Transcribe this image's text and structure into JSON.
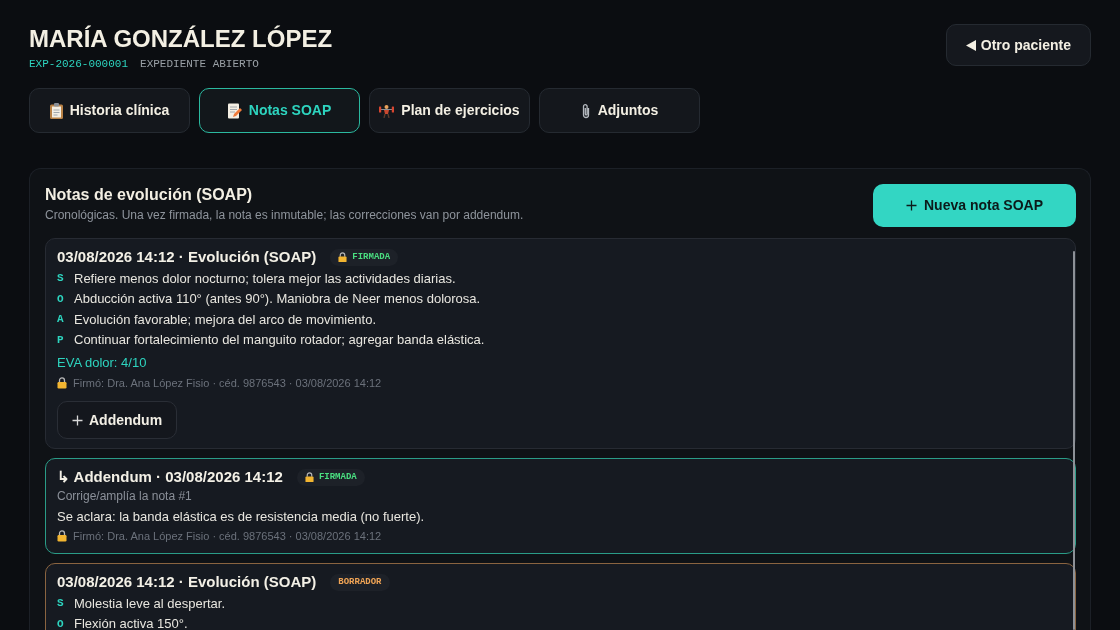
{
  "patient": {
    "name": "MARÍA GONZÁLEZ LÓPEZ",
    "record_id": "EXP-2026-000001",
    "record_status": "EXPEDIENTE ABIERTO"
  },
  "other_patient_button": {
    "label": "Otro paciente"
  },
  "tabs": [
    {
      "label": "Historia clínica",
      "selected": false
    },
    {
      "label": "Notas SOAP",
      "selected": true
    },
    {
      "label": "Plan de ejercicios",
      "selected": false
    },
    {
      "label": "Adjuntos",
      "selected": false
    }
  ],
  "panel": {
    "title": "Notas de evolución (SOAP)",
    "subtitle": "Cronológicas. Una vez firmada, la nota es inmutable; las correcciones van por addendum.",
    "new_note_button": "Nueva nota SOAP"
  },
  "notes": [
    {
      "kind": "soap",
      "heading": "03/08/2026 14:12 · Evolución (SOAP)",
      "status": "FIRMADA",
      "signed": true,
      "sections": [
        {
          "letter": "S",
          "text": "Refiere menos dolor nocturno; tolera mejor las actividades diarias."
        },
        {
          "letter": "O",
          "text": "Abducción activa 110° (antes 90°). Maniobra de Neer menos dolorosa."
        },
        {
          "letter": "A",
          "text": "Evolución favorable; mejora del arco de movimiento."
        },
        {
          "letter": "P",
          "text": "Continuar fortalecimiento del manguito rotador; agregar banda elástica."
        }
      ],
      "pain": "EVA dolor: 4/10",
      "signature": "Firmó: Dra. Ana López Fisio · céd. 9876543 · 03/08/2026 14:12",
      "action": "Addendum"
    },
    {
      "kind": "addendum",
      "heading": "↳ Addendum · 03/08/2026 14:12",
      "status": "FIRMADA",
      "signed": true,
      "reference": "Corrige/amplía la nota #1",
      "body": "Se aclara: la banda elástica es de resistencia media (no fuerte).",
      "signature": "Firmó: Dra. Ana López Fisio · céd. 9876543 · 03/08/2026 14:12"
    },
    {
      "kind": "soap",
      "heading": "03/08/2026 14:12 · Evolución (SOAP)",
      "status": "BORRADOR",
      "signed": false,
      "sections": [
        {
          "letter": "S",
          "text": "Molestia leve al despertar."
        },
        {
          "letter": "O",
          "text": "Flexión activa 150°."
        }
      ]
    }
  ]
}
